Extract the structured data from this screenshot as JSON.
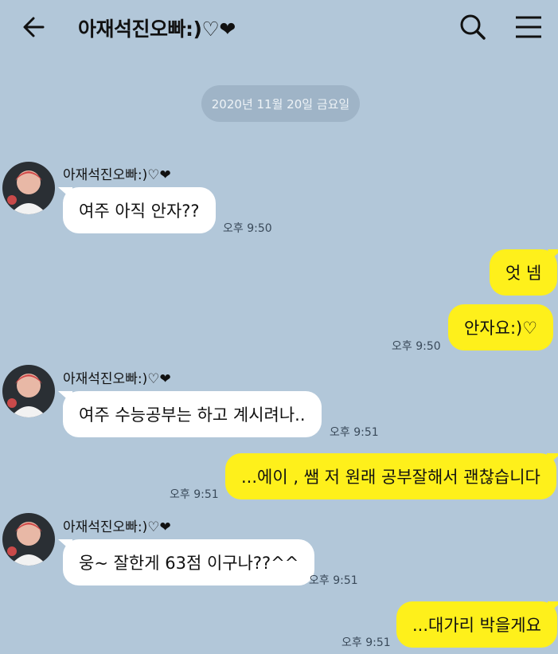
{
  "header": {
    "title": "아재석진오빠:)♡❤",
    "back_icon": "arrow-left-icon",
    "search_icon": "search-icon",
    "menu_icon": "hamburger-menu-icon"
  },
  "colors": {
    "background": "#b2c7d9",
    "incoming_bubble": "#ffffff",
    "outgoing_bubble": "#fef01b",
    "date_pill": "#9fb4c7"
  },
  "date_divider": "2020년 11월 20일 금요일",
  "messages": [
    {
      "direction": "in",
      "sender": "아재석진오빠:)♡❤",
      "text": "여주 아직 안자??",
      "time": "오후 9:50"
    },
    {
      "direction": "out",
      "text": "엇 넴",
      "time": ""
    },
    {
      "direction": "out",
      "text": "안자요:)♡",
      "time": "오후 9:50"
    },
    {
      "direction": "in",
      "sender": "아재석진오빠:)♡❤",
      "text": "여주 수능공부는 하고 계시려나..",
      "time": "오후 9:51"
    },
    {
      "direction": "out",
      "text": "...에이 , 쌤 저 원래 공부잘해서 괜찮습니다",
      "time": "오후 9:51"
    },
    {
      "direction": "in",
      "sender": "아재석진오빠:)♡❤",
      "text": "웅~ 잘한게 63점 이구나??^^",
      "time": "오후 9:51"
    },
    {
      "direction": "out",
      "text": "...대가리 박을게요",
      "time": "오후 9:51"
    }
  ]
}
